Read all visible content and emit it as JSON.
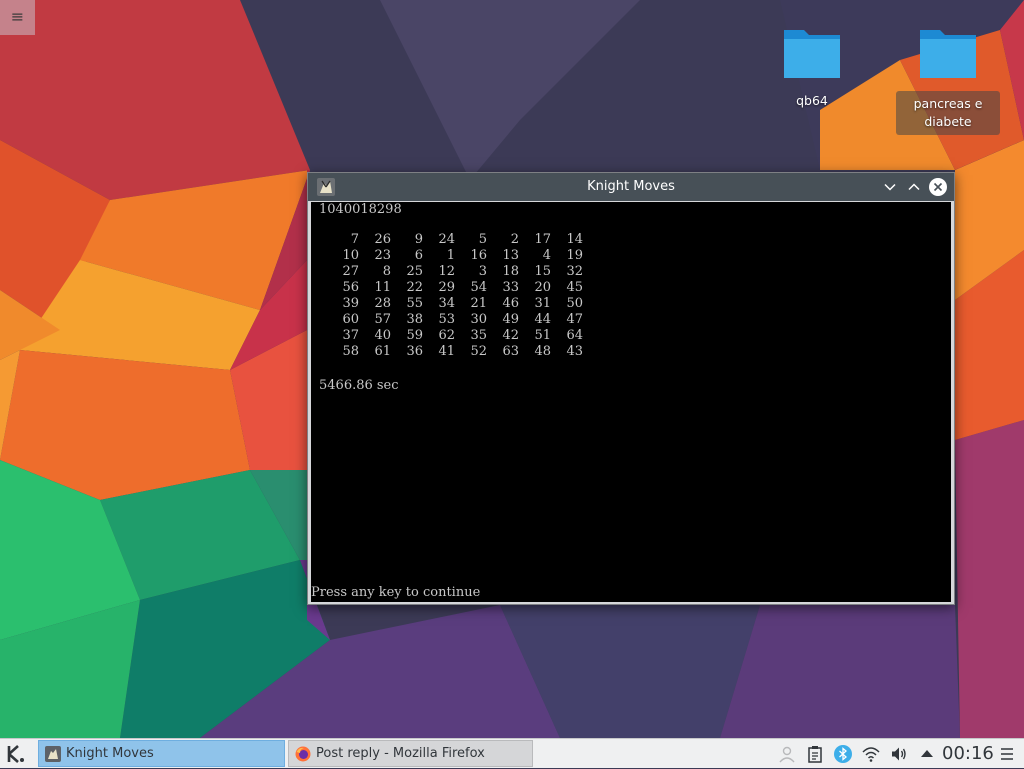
{
  "desktop": {
    "icons": [
      {
        "label": "qb64",
        "icon": "folder-icon",
        "selected": false
      },
      {
        "label": "pancreas e diabete",
        "icon": "folder-icon",
        "selected": true
      }
    ],
    "menu_icon": "≡"
  },
  "window": {
    "title": "Knight Moves",
    "app_icon": "knight-moves-icon",
    "buttons": [
      "minimize",
      "maximize",
      "close"
    ],
    "terminal": {
      "header": "1040018298",
      "board": [
        [
          7,
          26,
          9,
          24,
          5,
          2,
          17,
          14
        ],
        [
          10,
          23,
          6,
          1,
          16,
          13,
          4,
          19
        ],
        [
          27,
          8,
          25,
          12,
          3,
          18,
          15,
          32
        ],
        [
          56,
          11,
          22,
          29,
          54,
          33,
          20,
          45
        ],
        [
          39,
          28,
          55,
          34,
          21,
          46,
          31,
          50
        ],
        [
          60,
          57,
          38,
          53,
          30,
          49,
          44,
          47
        ],
        [
          37,
          40,
          59,
          62,
          35,
          42,
          51,
          64
        ],
        [
          58,
          61,
          36,
          41,
          52,
          63,
          48,
          43
        ]
      ],
      "timing": "5466.86 sec",
      "prompt": "Press any key to continue"
    }
  },
  "taskbar": {
    "tasks": [
      {
        "label": "Knight Moves",
        "icon": "knight-moves-icon",
        "active": true
      },
      {
        "label": "Post reply - Mozilla Firefox",
        "icon": "firefox-icon",
        "active": false
      }
    ],
    "tray": [
      "user-icon",
      "clipboard-icon",
      "bluetooth-icon",
      "wifi-icon",
      "volume-icon",
      "expand-arrow-icon"
    ],
    "clock": "00:16"
  },
  "colors": {
    "accent": "#3daee9",
    "taskbar_bg": "#eff0f1",
    "titlebar_bg": "#475057",
    "terminal_bg": "#000000",
    "terminal_fg": "#c8c8c8",
    "active_task": "#8fc3ea"
  }
}
